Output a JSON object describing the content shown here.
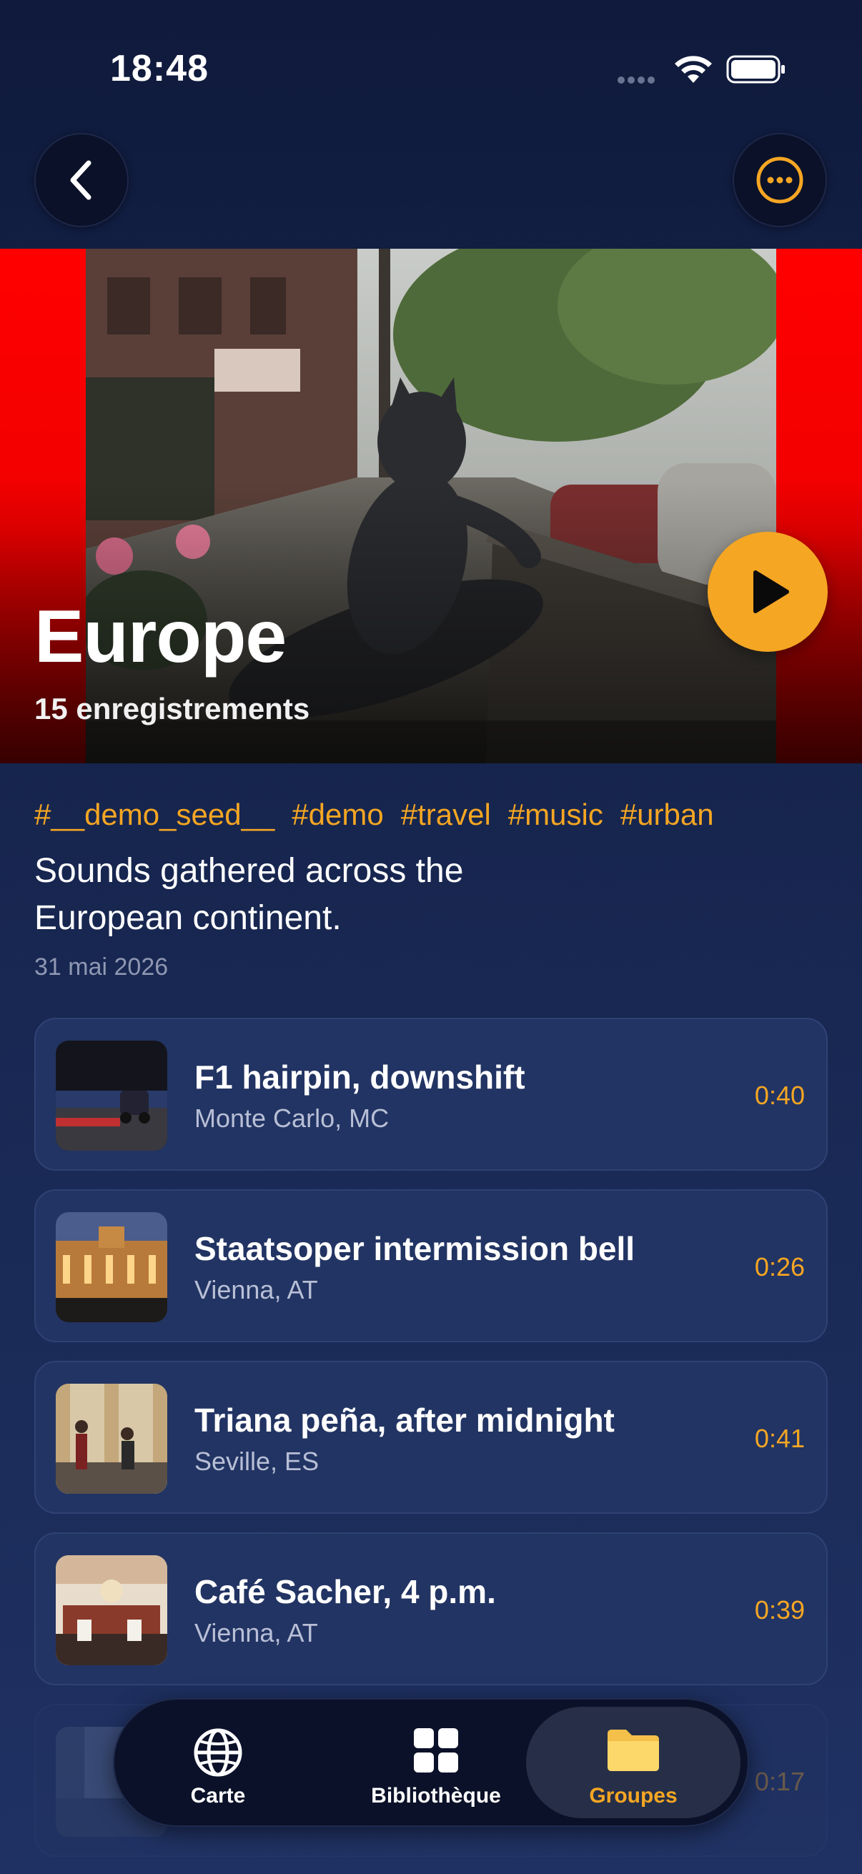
{
  "status_bar": {
    "time": "18:48"
  },
  "nav": {
    "back_icon": "chevron-left-icon",
    "more_icon": "ellipsis-circle-icon"
  },
  "hero": {
    "title": "Europe",
    "subtitle": "15 enregistrements",
    "play_icon": "play-icon"
  },
  "tags": [
    "#__demo_seed__",
    "#demo",
    "#travel",
    "#music",
    "#urban"
  ],
  "description": "Sounds gathered across the European continent.",
  "date": "31 mai 2026",
  "recordings": [
    {
      "title": "F1 hairpin, downshift",
      "location": "Monte Carlo, MC",
      "duration": "0:40"
    },
    {
      "title": "Staatsoper intermission bell",
      "location": "Vienna, AT",
      "duration": "0:26"
    },
    {
      "title": "Triana peña, after midnight",
      "location": "Seville, ES",
      "duration": "0:41"
    },
    {
      "title": "Café Sacher, 4 p.m.",
      "location": "Vienna, AT",
      "duration": "0:39"
    },
    {
      "title": "",
      "location": "",
      "duration": "0:17"
    }
  ],
  "tab_bar": {
    "tabs": [
      {
        "label": "Carte",
        "icon": "globe-icon"
      },
      {
        "label": "Bibliothèque",
        "icon": "grid-icon"
      },
      {
        "label": "Groupes",
        "icon": "folder-icon",
        "active": true
      }
    ]
  },
  "colors": {
    "accent": "#f5a623",
    "background": "#17264f",
    "card": "#223463",
    "hero_red": "#ff0000"
  }
}
